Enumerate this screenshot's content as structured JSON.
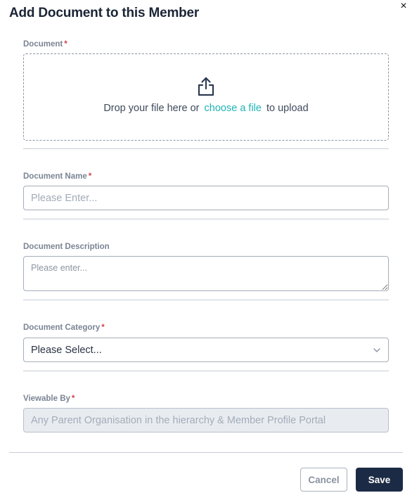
{
  "dialog": {
    "title": "Add Document to this Member",
    "close_glyph": "×"
  },
  "document_field": {
    "label": "Document",
    "required_mark": "*",
    "drop_text_before": "Drop your file here or",
    "drop_link": "choose a file",
    "drop_text_after": "to upload",
    "icon": "upload-icon"
  },
  "name_field": {
    "label": "Document Name",
    "required_mark": "*",
    "placeholder": "Please Enter..."
  },
  "description_field": {
    "label": "Document Description",
    "placeholder": "Please enter..."
  },
  "category_field": {
    "label": "Document Category",
    "required_mark": "*",
    "selected": "Please Select...",
    "icon": "chevron-down-icon"
  },
  "viewable_field": {
    "label": "Viewable By",
    "required_mark": "*",
    "value": "Any Parent Organisation in the hierarchy & Member Profile Portal"
  },
  "footer": {
    "cancel_label": "Cancel",
    "save_label": "Save"
  },
  "colors": {
    "accent_link": "#1fb3b6",
    "primary_button": "#1c2b45",
    "required": "#d0434b"
  }
}
